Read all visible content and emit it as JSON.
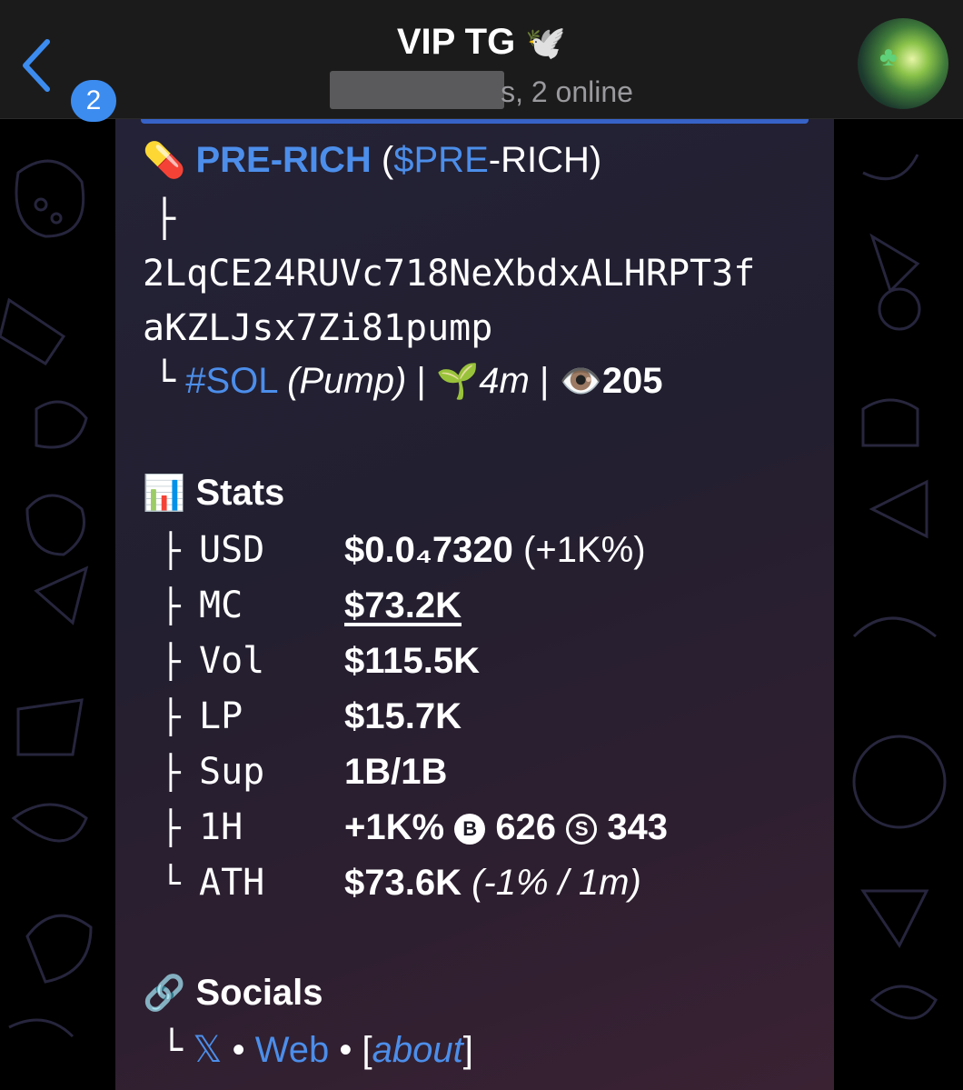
{
  "header": {
    "back_badge": "2",
    "title": "VIP TG",
    "title_emoji": "🕊️",
    "subtitle_suffix": "s, 2 online"
  },
  "message": {
    "token_icon": "💊",
    "token_name": "PRE-RICH",
    "ticker_open": "(",
    "ticker_link": "$PRE",
    "ticker_rest": "-RICH)",
    "tree_top": "├",
    "address_line1": "2LqCE24RUVc718NeXbdxALHRPT3f",
    "address_line2": "aKZLJsx7Zi81pump",
    "tree_end": "└",
    "chain_tag": "#SOL",
    "platform": "(Pump)",
    "sep": "|",
    "age_icon": "🌱",
    "age": "4m",
    "views_icon": "👁️",
    "views": "205",
    "stats_icon": "📊",
    "stats_title": "Stats",
    "stats": [
      {
        "tree": "├",
        "key": "USD",
        "value": "$0.0₄7320",
        "extra": " (+1K%)"
      },
      {
        "tree": "├",
        "key": "MC",
        "value": "$73.2K",
        "extra": ""
      },
      {
        "tree": "├",
        "key": "Vol",
        "value": "$115.5K",
        "extra": ""
      },
      {
        "tree": "├",
        "key": "LP",
        "value": "$15.7K",
        "extra": ""
      },
      {
        "tree": "├",
        "key": "Sup",
        "value": "1B/1B",
        "extra": ""
      },
      {
        "tree": "├",
        "key": "1H",
        "value": "+1K%",
        "b_icon": "B",
        "b_val": "626",
        "s_icon": "S",
        "s_val": "343"
      },
      {
        "tree": "└",
        "key": "ATH",
        "value": "$73.6K",
        "extra": " (-1% / 1m)"
      }
    ],
    "socials_icon": "🔗",
    "socials_title": "Socials",
    "social_x": "𝕏",
    "dot": "•",
    "social_web": "Web",
    "about_open": "[",
    "social_about": "about",
    "about_close": "]"
  }
}
